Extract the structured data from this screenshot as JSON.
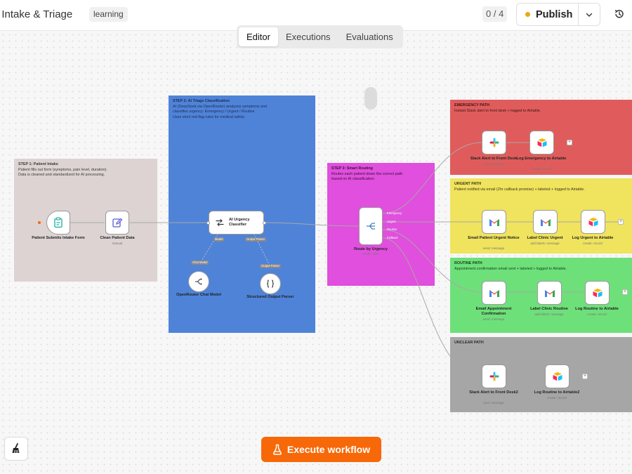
{
  "header": {
    "title": "t Intake & Triage",
    "tag": "learning",
    "counter": "0 / 4",
    "publish_label": "Publish"
  },
  "tabs": [
    {
      "label": "Editor",
      "active": true
    },
    {
      "label": "Executions",
      "active": false
    },
    {
      "label": "Evaluations",
      "active": false
    }
  ],
  "stickies": {
    "step1": {
      "title": "STEP 1: Patient Intake",
      "text": "Patient fills out form (symptoms, pain level, duration).\nData is cleaned and standardized for AI processing.",
      "color": "#ddd3d3"
    },
    "step2": {
      "title": "STEP 2: AI Triage Classification",
      "text": "AI (DeepSeek via OpenRouter) analyzes symptoms and\nclassifies urgency: Emergency / Urgent / Routine\nUses strict red-flag rules for medical safety.",
      "color": "#4f83d8"
    },
    "step3": {
      "title": "STEP 3: Smart Routing",
      "text": "Routes each patient down the correct path\nbased on AI classification.",
      "color": "#e04fdd"
    },
    "emergency": {
      "title": "EMERGENCY PATH",
      "text": "Instant Slack alert to front desk + logged to Airtable.",
      "color": "#e05c5c"
    },
    "urgent": {
      "title": "URGENT PATH",
      "text": "Patient notified via email (2hr callback promise) + labeled + logged to Airtable.",
      "color": "#f0e35e"
    },
    "routine": {
      "title": "ROUTINE PATH",
      "text": "Appointment confirmation email sent + labeled + logged to Airtable.",
      "color": "#6ee07a"
    },
    "unclear": {
      "title": "UNCLEAR PATH",
      "text": "",
      "color": "#a6a6a6"
    }
  },
  "nodes": {
    "form": {
      "label": "Patient Submits Intake Form",
      "sub": ""
    },
    "clean": {
      "label": "Clean Patient Data",
      "sub": "manual"
    },
    "classifier": {
      "label": "AI Urgency Classifier",
      "sub": ""
    },
    "chat_model": {
      "label": "OpenRouter Chat Model",
      "sub": ""
    },
    "parser": {
      "label": "Structured Output Parser",
      "sub": ""
    },
    "router": {
      "label": "Route by Urgency",
      "sub": "mode: rules"
    },
    "slack1": {
      "label": "Slack Alert to Front Desk",
      "sub": "post: message"
    },
    "air_em": {
      "label": "Log Emergency to Airtable",
      "sub": "create: record"
    },
    "gmail_urgent": {
      "label": "Email Patient Urgent Notice",
      "sub": "send: message"
    },
    "label_urgent": {
      "label": "Label Clinic Urgent",
      "sub": "add labels: message"
    },
    "air_urgent": {
      "label": "Log Urgent to Airtable",
      "sub": "create: record"
    },
    "gmail_routine": {
      "label": "Email Appointment Confirmation",
      "sub": "send: message"
    },
    "label_routine": {
      "label": "Label Clinic Routine",
      "sub": "add labels: message"
    },
    "air_routine": {
      "label": "Log Routine to Airtable",
      "sub": "create: record"
    },
    "slack2": {
      "label": "Slack Alert to Front Desk2",
      "sub": "post: message"
    },
    "air_routine2": {
      "label": "Log Routine to Airtable2",
      "sub": "create: record"
    }
  },
  "sub_labels": {
    "model": "Model",
    "output_parser": "Output Parser",
    "chat_model": "Chat Model",
    "parser": "Output Parser"
  },
  "router_outputs": [
    "Emergency",
    "Urgent",
    "Routine",
    "Fallback"
  ],
  "execute_label": "Execute workflow",
  "colors": {
    "accent": "#f76808",
    "publish_dot": "#e6a919",
    "trigger": "#f76808"
  }
}
